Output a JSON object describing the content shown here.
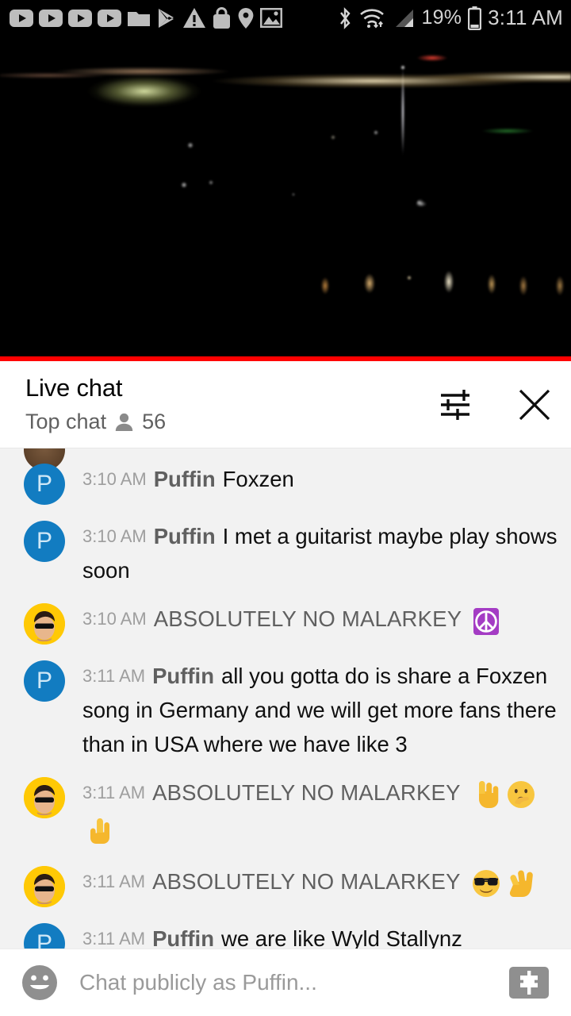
{
  "status_bar": {
    "time": "3:11 AM",
    "battery_percent": "19%",
    "left_icons": [
      "youtube-icon",
      "youtube-icon",
      "youtube-icon",
      "youtube-icon",
      "folder-icon",
      "play-store-icon",
      "warning-triangle-icon",
      "shopping-bag-icon",
      "location-pin-icon",
      "image-icon"
    ],
    "right_icons": [
      "bluetooth-icon",
      "wifi-icon",
      "cellular-signal-icon",
      "battery-icon"
    ]
  },
  "video": {
    "progress_percent": 100,
    "progress_color": "#ff0000",
    "description": "night cityscape with lights"
  },
  "chat_header": {
    "title": "Live chat",
    "mode": "Top chat",
    "viewer_count": "56",
    "settings_icon": "tune-sliders-icon",
    "close_icon": "close-icon"
  },
  "messages": [
    {
      "time": "3:10 AM",
      "author": "Puffin",
      "author_style": "normal",
      "avatar": "P",
      "avatar_type": "letter",
      "text": "Foxzen",
      "emojis": []
    },
    {
      "time": "3:10 AM",
      "author": "Puffin",
      "author_style": "normal",
      "avatar": "P",
      "avatar_type": "letter",
      "text": "I met a guitarist maybe play shows soon",
      "emojis": []
    },
    {
      "time": "3:10 AM",
      "author": "ABSOLUTELY NO MALARKEY",
      "author_style": "caps",
      "avatar": "face-sunglasses",
      "avatar_type": "photo",
      "text": "",
      "emojis": [
        "peace-symbol-emoji"
      ]
    },
    {
      "time": "3:11 AM",
      "author": "Puffin",
      "author_style": "normal",
      "avatar": "P",
      "avatar_type": "letter",
      "text": "all you gotta do is share a Foxzen song in Germany and we will get more fans there than in USA where we have like 3",
      "emojis": []
    },
    {
      "time": "3:11 AM",
      "author": "ABSOLUTELY NO MALARKEY",
      "author_style": "caps",
      "avatar": "face-sunglasses",
      "avatar_type": "photo",
      "text": "",
      "emojis": [
        "point-down-emoji",
        "shushing-face-emoji",
        "point-up-emoji"
      ]
    },
    {
      "time": "3:11 AM",
      "author": "ABSOLUTELY NO MALARKEY",
      "author_style": "caps",
      "avatar": "face-sunglasses",
      "avatar_type": "photo",
      "text": "",
      "emojis": [
        "sunglasses-face-emoji",
        "victory-hand-emoji"
      ]
    },
    {
      "time": "3:11 AM",
      "author": "Puffin",
      "author_style": "normal",
      "avatar": "P",
      "avatar_type": "letter",
      "text": "we are like Wyld Stallynz",
      "emojis": []
    }
  ],
  "input_bar": {
    "emoji_icon": "smiley-face-icon",
    "placeholder": "Chat publicly as Puffin...",
    "value": "",
    "superchat_icon": "dollar-bill-icon"
  },
  "colors": {
    "accent_red": "#ff0000",
    "avatar_blue": "#127cc1",
    "avatar_yellow": "#ffc905",
    "chat_bg": "#f2f2f2"
  }
}
